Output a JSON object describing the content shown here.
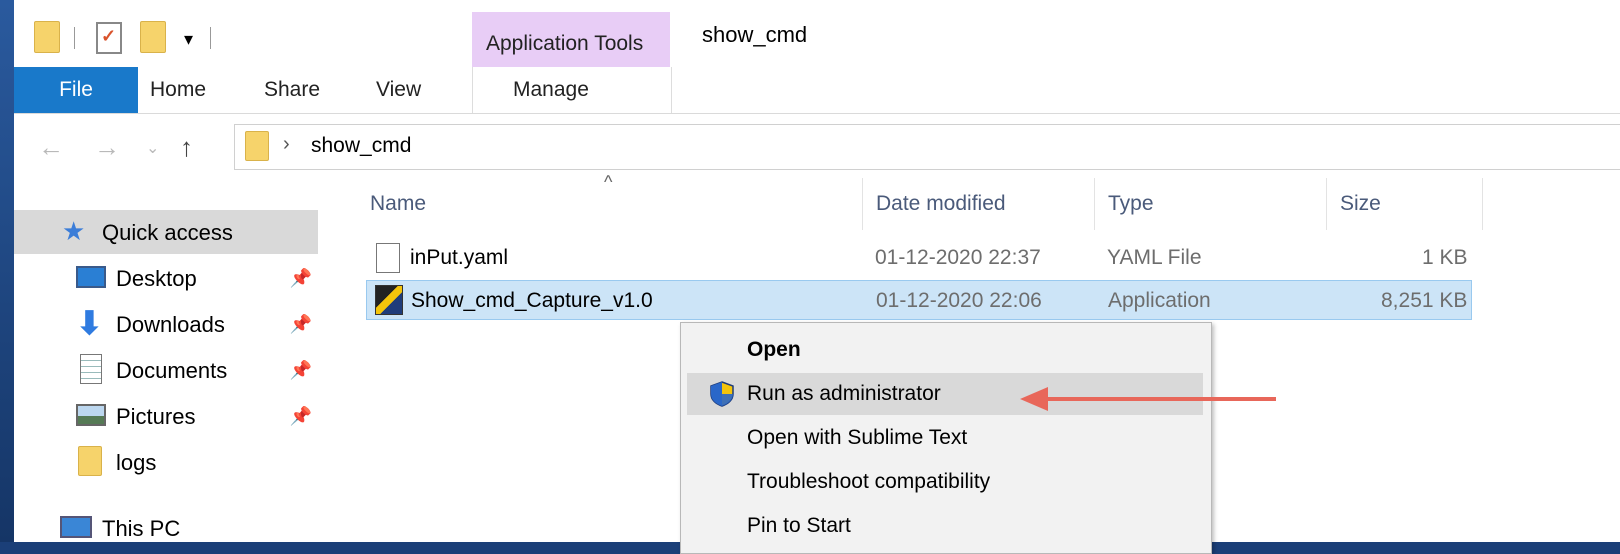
{
  "window": {
    "title": "show_cmd",
    "context_tab_group": "Application Tools"
  },
  "ribbon": {
    "tabs": [
      {
        "label": "File"
      },
      {
        "label": "Home"
      },
      {
        "label": "Share"
      },
      {
        "label": "View"
      },
      {
        "label": "Manage"
      }
    ]
  },
  "address": {
    "path": "show_cmd"
  },
  "navpane": {
    "items": [
      {
        "label": "Quick access",
        "icon": "star-icon"
      },
      {
        "label": "Desktop",
        "icon": "desktop-icon",
        "pinned": true
      },
      {
        "label": "Downloads",
        "icon": "download-arrow-icon",
        "pinned": true
      },
      {
        "label": "Documents",
        "icon": "document-icon",
        "pinned": true
      },
      {
        "label": "Pictures",
        "icon": "pictures-icon",
        "pinned": true
      },
      {
        "label": "logs",
        "icon": "folder-icon"
      },
      {
        "label": "This PC",
        "icon": "computer-icon"
      }
    ]
  },
  "filelist": {
    "columns": [
      "Name",
      "Date modified",
      "Type",
      "Size"
    ],
    "rows": [
      {
        "name": "inPut.yaml",
        "date": "01-12-2020 22:37",
        "type": "YAML File",
        "size": "1 KB"
      },
      {
        "name": "Show_cmd_Capture_v1.0",
        "date": "01-12-2020 22:06",
        "type": "Application",
        "size": "8,251 KB"
      }
    ]
  },
  "context_menu": {
    "items": [
      {
        "label": "Open",
        "default": true
      },
      {
        "label": "Run as administrator",
        "icon": "uac-shield-icon",
        "highlighted": true
      },
      {
        "label": "Open with Sublime Text"
      },
      {
        "label": "Troubleshoot compatibility"
      },
      {
        "label": "Pin to Start"
      }
    ]
  },
  "colors": {
    "file_tab": "#1979ca",
    "context_tab": "#e8cdf6",
    "selection": "#cce4f7",
    "annotation_arrow": "#e8675a"
  }
}
